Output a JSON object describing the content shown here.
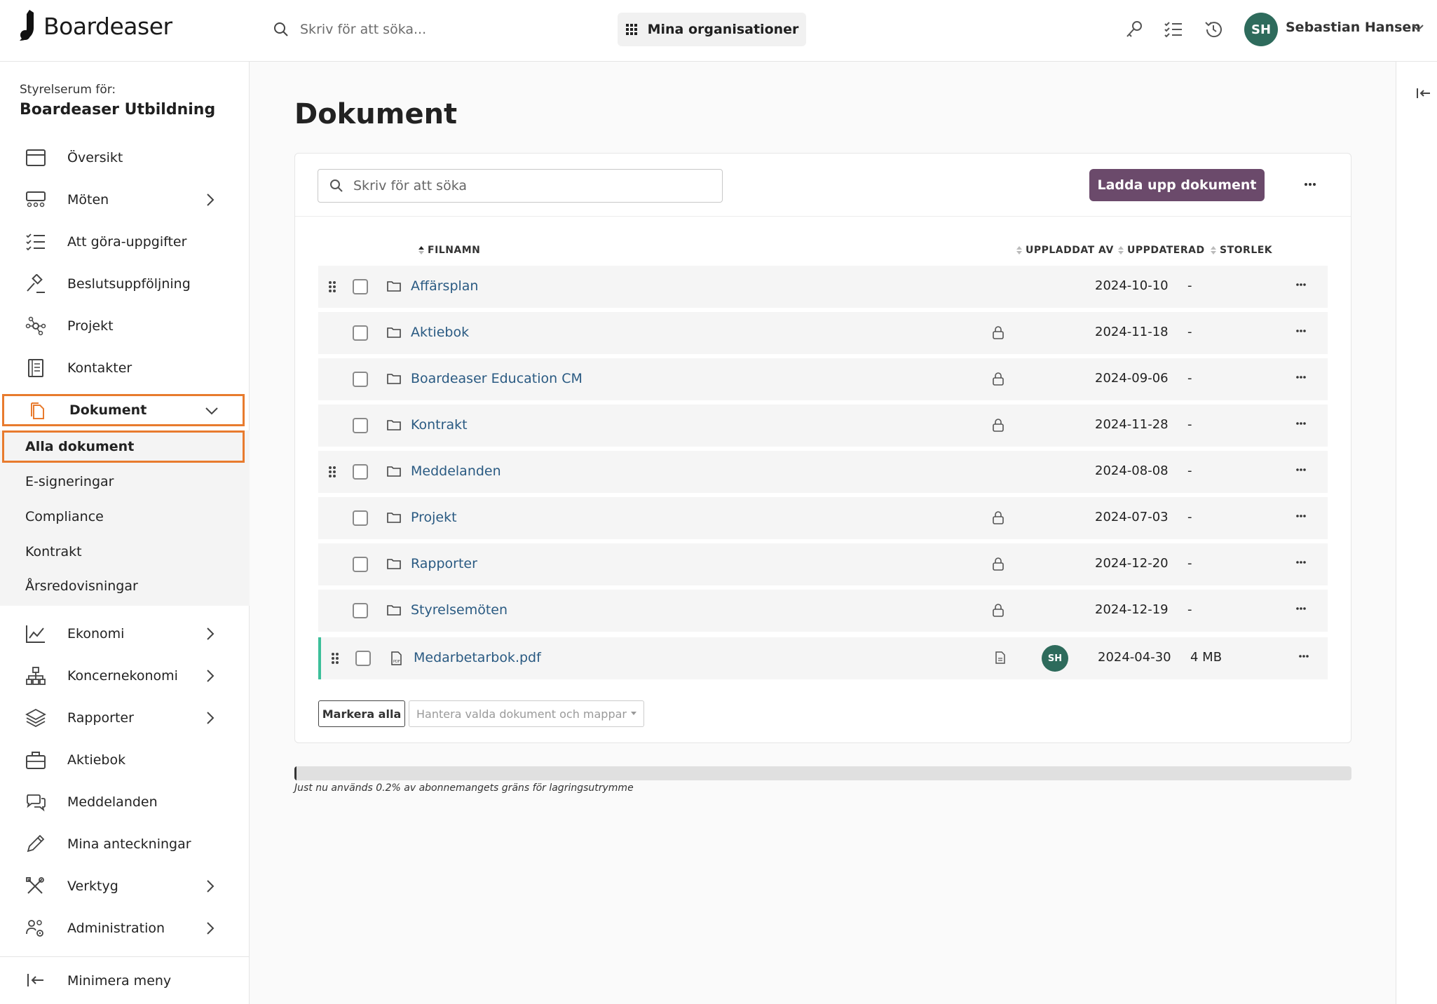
{
  "app": {
    "brand": "Boardeaser",
    "search_placeholder": "Skriv för att söka...",
    "org_button": "Mina organisationer",
    "user": {
      "initials": "SH",
      "name": "Sebastian Hansen"
    }
  },
  "sidebar": {
    "room_label": "Styrelserum för:",
    "room_name": "Boardeaser Utbildning",
    "items": [
      {
        "label": "Översikt",
        "icon": "calendar-icon",
        "has_children": false
      },
      {
        "label": "Möten",
        "icon": "meeting-icon",
        "has_children": true
      },
      {
        "label": "Att göra-uppgifter",
        "icon": "checklist-icon",
        "has_children": false
      },
      {
        "label": "Beslutsuppföljning",
        "icon": "gavel-icon",
        "has_children": false
      },
      {
        "label": "Projekt",
        "icon": "network-icon",
        "has_children": false
      },
      {
        "label": "Kontakter",
        "icon": "contacts-book-icon",
        "has_children": false
      },
      {
        "label": "Dokument",
        "icon": "documents-icon",
        "has_children": true,
        "expanded": true
      },
      {
        "label": "Ekonomi",
        "icon": "line-chart-icon",
        "has_children": true
      },
      {
        "label": "Koncernekonomi",
        "icon": "org-tree-icon",
        "has_children": true
      },
      {
        "label": "Rapporter",
        "icon": "layers-icon",
        "has_children": true
      },
      {
        "label": "Aktiebok",
        "icon": "briefcase-icon",
        "has_children": false
      },
      {
        "label": "Meddelanden",
        "icon": "chat-icon",
        "has_children": false
      },
      {
        "label": "Mina anteckningar",
        "icon": "pencil-icon",
        "has_children": false
      },
      {
        "label": "Verktyg",
        "icon": "tools-icon",
        "has_children": true
      },
      {
        "label": "Administration",
        "icon": "users-gear-icon",
        "has_children": true
      }
    ],
    "subitems": [
      "Alla dokument",
      "E-signeringar",
      "Compliance",
      "Kontrakt",
      "Årsredovisningar"
    ],
    "minimize": "Minimera meny"
  },
  "main": {
    "title": "Dokument",
    "search_placeholder": "Skriv för att söka",
    "upload_button": "Ladda upp dokument",
    "columns": {
      "filename": "FILNAMN",
      "uploaded_by": "UPPLADDAT AV",
      "updated": "UPPDATERAD",
      "size": "STORLEK"
    },
    "rows": [
      {
        "name": "Affärsplan",
        "type": "folder",
        "locked": false,
        "draggable": true,
        "uploaded_by": "",
        "updated": "2024-10-10",
        "size": "-"
      },
      {
        "name": "Aktiebok",
        "type": "folder",
        "locked": true,
        "draggable": false,
        "uploaded_by": "",
        "updated": "2024-11-18",
        "size": "-"
      },
      {
        "name": "Boardeaser Education CM",
        "type": "folder",
        "locked": true,
        "draggable": false,
        "uploaded_by": "",
        "updated": "2024-09-06",
        "size": "-"
      },
      {
        "name": "Kontrakt",
        "type": "folder",
        "locked": true,
        "draggable": false,
        "uploaded_by": "",
        "updated": "2024-11-28",
        "size": "-"
      },
      {
        "name": "Meddelanden",
        "type": "folder",
        "locked": false,
        "draggable": true,
        "uploaded_by": "",
        "updated": "2024-08-08",
        "size": "-"
      },
      {
        "name": "Projekt",
        "type": "folder",
        "locked": true,
        "draggable": false,
        "uploaded_by": "",
        "updated": "2024-07-03",
        "size": "-"
      },
      {
        "name": "Rapporter",
        "type": "folder",
        "locked": true,
        "draggable": false,
        "uploaded_by": "",
        "updated": "2024-12-20",
        "size": "-"
      },
      {
        "name": "Styrelsemöten",
        "type": "folder",
        "locked": true,
        "draggable": false,
        "uploaded_by": "",
        "updated": "2024-12-19",
        "size": "-"
      },
      {
        "name": "Medarbetarbok.pdf",
        "type": "pdf",
        "locked": false,
        "draggable": true,
        "uploaded_by": "SH",
        "updated": "2024-04-30",
        "size": "4 MB"
      }
    ],
    "mark_all": "Markera alla",
    "manage_selected": "Hantera valda dokument och mappar",
    "storage_used_fraction": 0.002,
    "storage_text": "Just nu används 0.2% av abonnemangets gräns för lagringsutrymme"
  },
  "colors": {
    "accent": "#6b4a6b",
    "avatar": "#2e6b5c",
    "highlight": "#e87b2e",
    "link": "#2a5a82",
    "file_marker": "#3cbf9a"
  }
}
